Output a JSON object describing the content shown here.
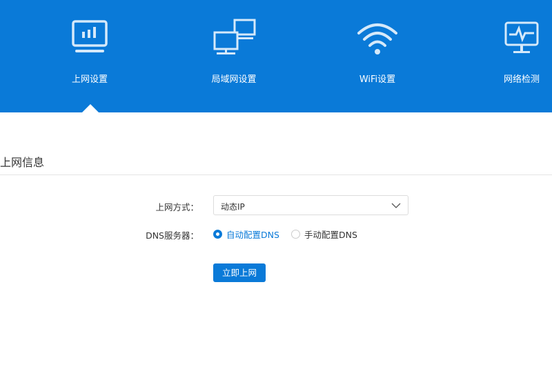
{
  "nav": [
    {
      "label": "上网设置",
      "icon": "monitor-chart-icon"
    },
    {
      "label": "局域网设置",
      "icon": "lan-monitors-icon"
    },
    {
      "label": "WiFi设置",
      "icon": "wifi-icon"
    },
    {
      "label": "网络检测",
      "icon": "monitor-pulse-icon"
    }
  ],
  "section_title": "上网信息",
  "form": {
    "connection_label": "上网方式：",
    "connection_value": "动态IP",
    "dns_label": "DNS服务器：",
    "dns_auto": "自动配置DNS",
    "dns_manual": "手动配置DNS",
    "dns_selected": "auto",
    "submit": "立即上网"
  },
  "colors": {
    "brand": "#0a7ad8"
  }
}
